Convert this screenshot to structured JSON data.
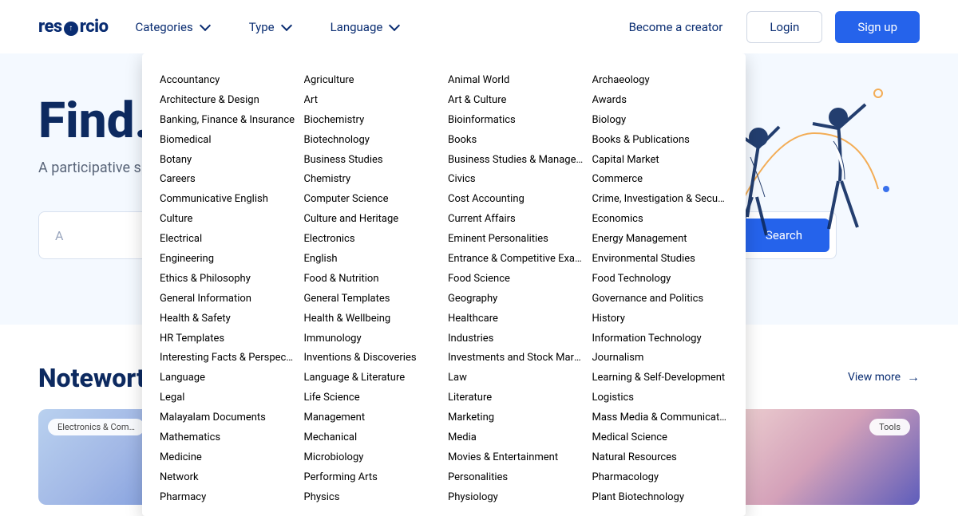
{
  "logo_text": "resorcio",
  "nav": {
    "categories": "Categories",
    "type": "Type",
    "language": "Language"
  },
  "header": {
    "become_creator": "Become a creator",
    "login": "Login",
    "signup": "Sign up"
  },
  "hero": {
    "headline_prefix": "Find.",
    "subtitle": "A participative space",
    "search_placeholder": "A",
    "search_button": "Search"
  },
  "noteworthy": {
    "title": "Noteworthy",
    "view_more": "View more",
    "tag1": "Electronics & Com…",
    "tag4": "Tools"
  },
  "categories_columns": [
    [
      "Accountancy",
      "Architecture & Design",
      "Banking, Finance & Insurance",
      "Biomedical",
      "Botany",
      "Careers",
      "Communicative English",
      "Culture",
      "Electrical",
      "Engineering",
      "Ethics & Philosophy",
      "General Information",
      "Health & Safety",
      "HR Templates",
      "Interesting Facts & Perspectives",
      "Language",
      "Legal",
      "Malayalam Documents",
      "Mathematics",
      "Medicine",
      "Network",
      "Pharmacy"
    ],
    [
      "Agriculture",
      "Art",
      "Biochemistry",
      "Biotechnology",
      "Business Studies",
      "Chemistry",
      "Computer Science",
      "Culture and Heritage",
      "Electronics",
      "English",
      "Food & Nutrition",
      "General Templates",
      "Health & Wellbeing",
      "Immunology",
      "Inventions & Discoveries",
      "Language & Literature",
      "Life Science",
      "Management",
      "Mechanical",
      "Microbiology",
      "Performing Arts",
      "Physics"
    ],
    [
      "Animal World",
      "Art & Culture",
      "Bioinformatics",
      "Books",
      "Business Studies & Manageme...",
      "Civics",
      "Cost Accounting",
      "Current Affairs",
      "Eminent Personalities",
      "Entrance & Competitive Exami...",
      "Food Science",
      "Geography",
      "Healthcare",
      "Industries",
      "Investments and Stock Market",
      "Law",
      "Literature",
      "Marketing",
      "Media",
      "Movies & Entertainment",
      "Personalities",
      "Physiology"
    ],
    [
      "Archaeology",
      "Awards",
      "Biology",
      "Books & Publications",
      "Capital Market",
      "Commerce",
      "Crime, Investigation & Security",
      "Economics",
      "Energy Management",
      "Environmental Studies",
      "Food Technology",
      "Governance and Politics",
      "History",
      "Information Technology",
      "Journalism",
      "Learning & Self-Development",
      "Logistics",
      "Mass Media & Communication",
      "Medical Science",
      "Natural Resources",
      "Pharmacology",
      "Plant Biotechnology"
    ]
  ]
}
